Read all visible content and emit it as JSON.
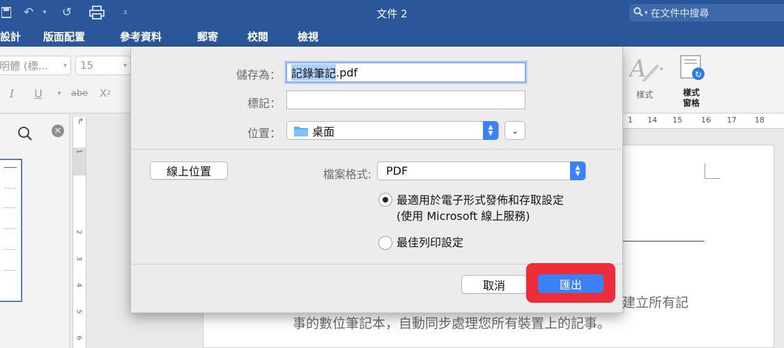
{
  "window": {
    "title": "文件 2",
    "search_placeholder": "在文件中搜尋"
  },
  "ribbon_tabs": [
    "設計",
    "版面配置",
    "參考資料",
    "郵寄",
    "校閱",
    "檢視"
  ],
  "ribbon": {
    "font_name": "明體 (標...",
    "font_size": "15",
    "styles_label": "樣式",
    "styles_pane_label_line1": "樣式",
    "styles_pane_label_line2": "窗格"
  },
  "ruler": {
    "marks": [
      "14",
      "15",
      "16",
      "17",
      "18"
    ]
  },
  "dialog": {
    "save_as_label": "儲存為：",
    "filename_selected": "記錄筆記",
    "filename_ext": ".pdf",
    "tags_label": "標記：",
    "tags_value": "",
    "location_label": "位置：",
    "location_value": "桌面",
    "online_locations_button": "線上位置",
    "file_format_label": "檔案格式:",
    "file_format_value": "PDF",
    "option_electronic_line1": "最適用於電子形式發佈和存取設定",
    "option_electronic_line2": "(使用 Microsoft 線上服務)",
    "option_print": "最佳列印設定",
    "selected_option": "electronic",
    "cancel_button": "取消",
    "export_button": "匯出"
  },
  "document": {
    "line1_fragment": "建立所有記",
    "line2": "事的數位筆記本，自動同步處理您所有裝置上的記事。"
  },
  "colors": {
    "title_bar": "#2b579a",
    "accent_blue": "#3b82f6",
    "highlight_red": "#ee2d3b"
  }
}
